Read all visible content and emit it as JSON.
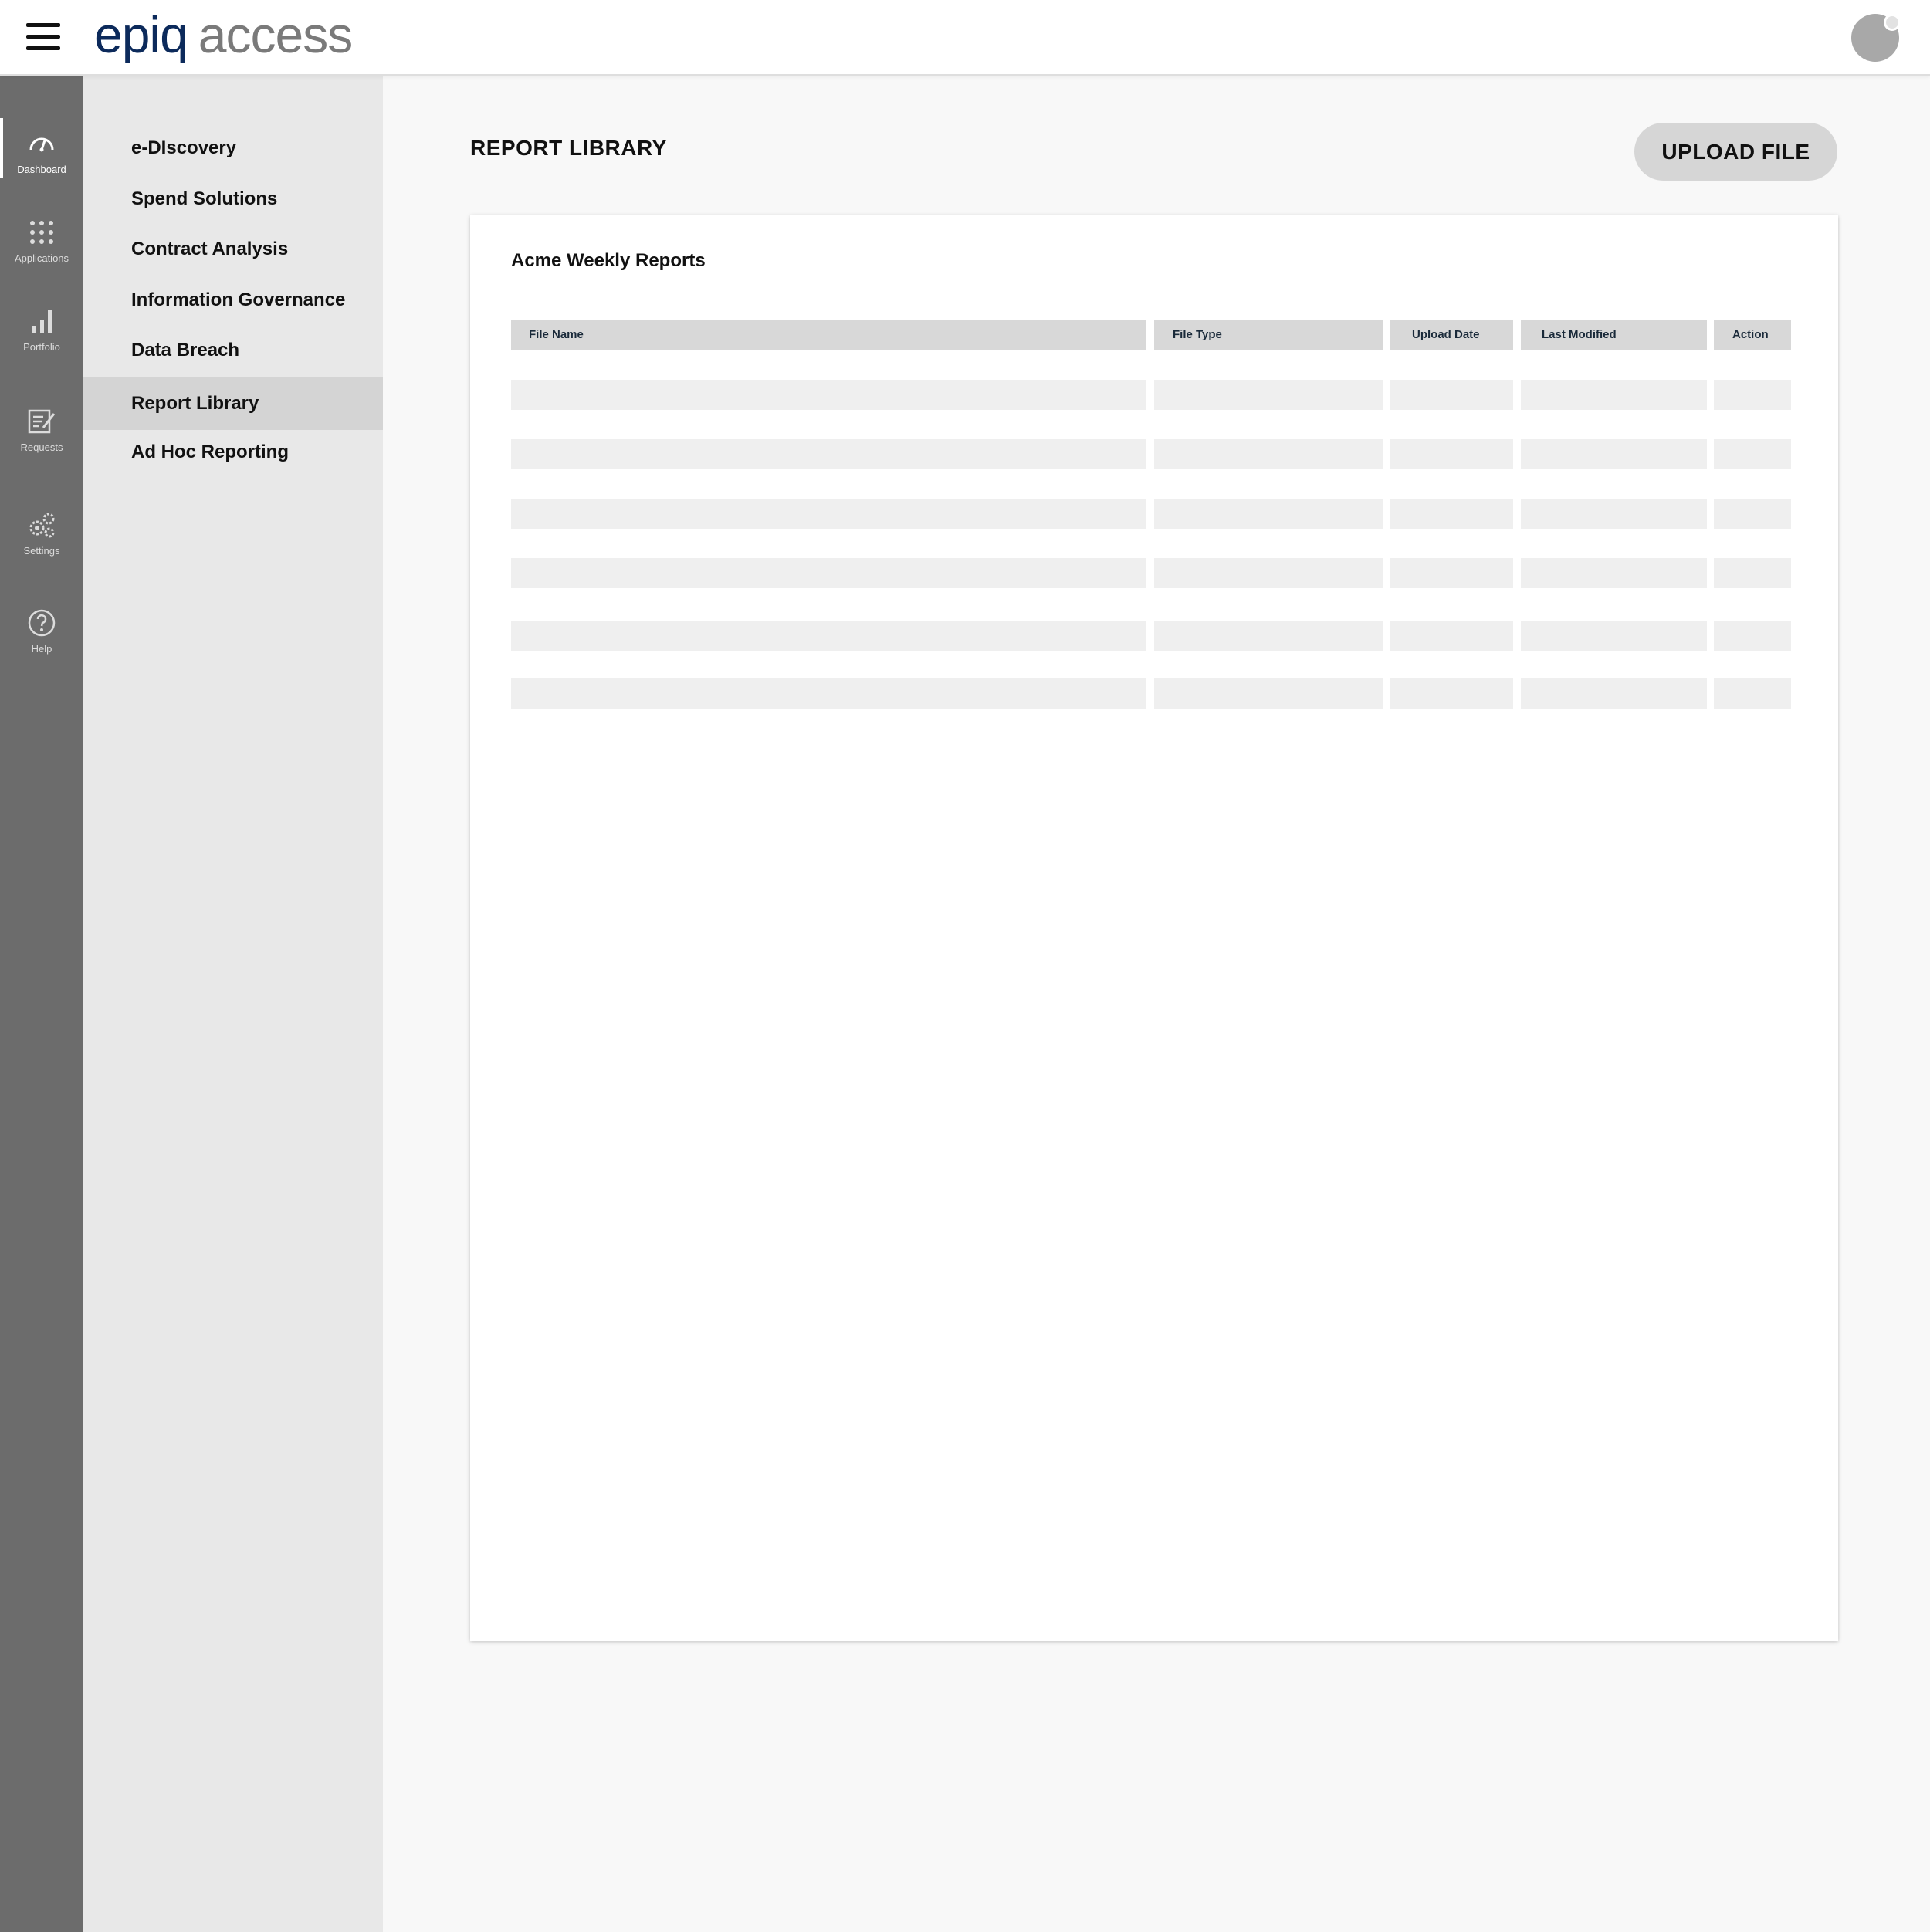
{
  "header": {
    "logo_part1": "epi",
    "logo_part2": "q",
    "logo_part3": "access"
  },
  "rail": {
    "items": [
      {
        "label": "Dashboard",
        "icon": "gauge-icon"
      },
      {
        "label": "Applications",
        "icon": "grid-icon"
      },
      {
        "label": "Portfolio",
        "icon": "bar-chart-icon"
      },
      {
        "label": "Requests",
        "icon": "document-edit-icon"
      },
      {
        "label": "Settings",
        "icon": "gears-icon"
      },
      {
        "label": "Help",
        "icon": "help-icon"
      }
    ],
    "active": "Dashboard"
  },
  "subnav": {
    "items": [
      {
        "label": "e-DIscovery"
      },
      {
        "label": "Spend Solutions"
      },
      {
        "label": "Contract Analysis"
      },
      {
        "label": "Information Governance"
      },
      {
        "label": "Data Breach"
      },
      {
        "label": "Report Library"
      },
      {
        "label": "Ad Hoc Reporting"
      }
    ],
    "active": "Report Library"
  },
  "main": {
    "title": "REPORT LIBRARY",
    "upload_label": "UPLOAD FILE",
    "card": {
      "title": "Acme Weekly Reports",
      "columns": [
        "File Name",
        "File Type",
        "Upload Date",
        "Last Modified",
        "Action"
      ],
      "rows": [
        [
          "",
          "",
          "",
          "",
          ""
        ],
        [
          "",
          "",
          "",
          "",
          ""
        ],
        [
          "",
          "",
          "",
          "",
          ""
        ],
        [
          "",
          "",
          "",
          "",
          ""
        ],
        [
          "",
          "",
          "",
          "",
          ""
        ],
        [
          "",
          "",
          "",
          "",
          ""
        ]
      ]
    }
  },
  "colors": {
    "brand_dark": "#0c2a5b",
    "brand_grey": "#7a7a7a",
    "rail_bg": "#6c6c6c",
    "subnav_bg": "#e8e8e8",
    "subnav_active": "#d4d4d4"
  }
}
